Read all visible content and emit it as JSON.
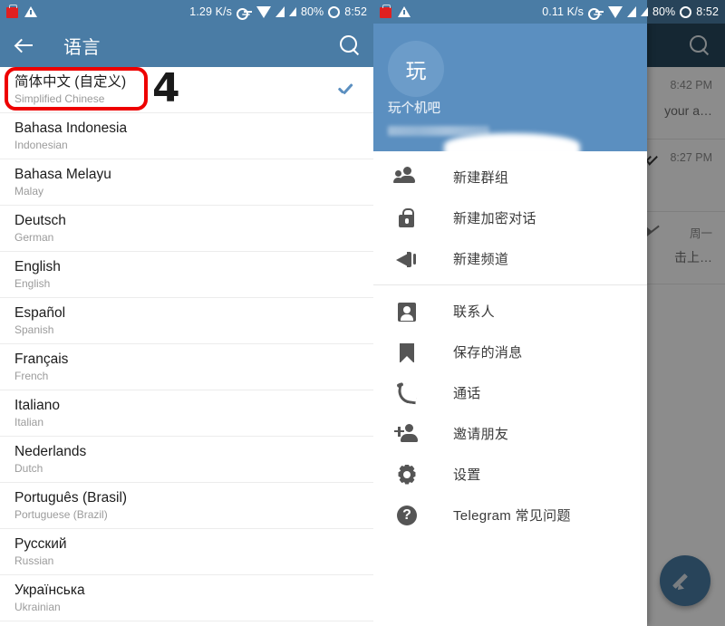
{
  "left": {
    "statusbar": {
      "speed": "1.29 K/s",
      "battery": "80%",
      "time": "8:52",
      "icons": [
        "red-box-icon",
        "warning-icon",
        "vpn-key-icon",
        "wifi-icon",
        "signal-icon",
        "signal-icon",
        "battery-icon"
      ]
    },
    "toolbar": {
      "back_icon": "back-arrow-icon",
      "title": "语言",
      "search_icon": "search-icon"
    },
    "languages": [
      {
        "name": "简体中文 (自定义)",
        "sub": "Simplified Chinese",
        "selected": true
      },
      {
        "name": "Bahasa Indonesia",
        "sub": "Indonesian",
        "selected": false
      },
      {
        "name": "Bahasa Melayu",
        "sub": "Malay",
        "selected": false
      },
      {
        "name": "Deutsch",
        "sub": "German",
        "selected": false
      },
      {
        "name": "English",
        "sub": "English",
        "selected": false
      },
      {
        "name": "Español",
        "sub": "Spanish",
        "selected": false
      },
      {
        "name": "Français",
        "sub": "French",
        "selected": false
      },
      {
        "name": "Italiano",
        "sub": "Italian",
        "selected": false
      },
      {
        "name": "Nederlands",
        "sub": "Dutch",
        "selected": false
      },
      {
        "name": "Português (Brasil)",
        "sub": "Portuguese (Brazil)",
        "selected": false
      },
      {
        "name": "Русский",
        "sub": "Russian",
        "selected": false
      },
      {
        "name": "Українська",
        "sub": "Ukrainian",
        "selected": false
      }
    ],
    "annotation": {
      "step_number": "4",
      "highlight_color": "#ee0000"
    }
  },
  "right": {
    "statusbar": {
      "speed": "0.11 K/s",
      "battery": "80%",
      "time": "8:52"
    },
    "chat_background": {
      "search_icon": "search-icon",
      "rows": [
        {
          "time": "8:42 PM",
          "snippet": "your a…",
          "ticks": false,
          "muted": false
        },
        {
          "time": "8:27 PM",
          "snippet": "",
          "ticks": true,
          "muted": false
        },
        {
          "time": "周一",
          "snippet": "击上…",
          "ticks": false,
          "muted": true
        }
      ],
      "fab_icon": "pencil-icon"
    },
    "drawer": {
      "avatar_initial": "玩",
      "user_name": "玩个机吧",
      "phone_redacted": true,
      "sections": [
        {
          "items": [
            {
              "icon": "group-icon",
              "label": "新建群组"
            },
            {
              "icon": "lock-icon",
              "label": "新建加密对话"
            },
            {
              "icon": "megaphone-icon",
              "label": "新建频道"
            }
          ]
        },
        {
          "items": [
            {
              "icon": "contact-icon",
              "label": "联系人"
            },
            {
              "icon": "bookmark-icon",
              "label": "保存的消息"
            },
            {
              "icon": "phone-icon",
              "label": "通话"
            },
            {
              "icon": "add-person-icon",
              "label": "邀请朋友"
            },
            {
              "icon": "gear-icon",
              "label": "设置"
            },
            {
              "icon": "help-icon",
              "label": "Telegram 常见问题"
            }
          ]
        }
      ]
    }
  },
  "colors": {
    "toolbar_blue": "#4a7ca5",
    "drawer_header_blue": "#5b8fc0",
    "chat_toolbar_dark": "#27485e",
    "accent_check": "#5b8fc0",
    "annotation_red": "#ee0000"
  }
}
